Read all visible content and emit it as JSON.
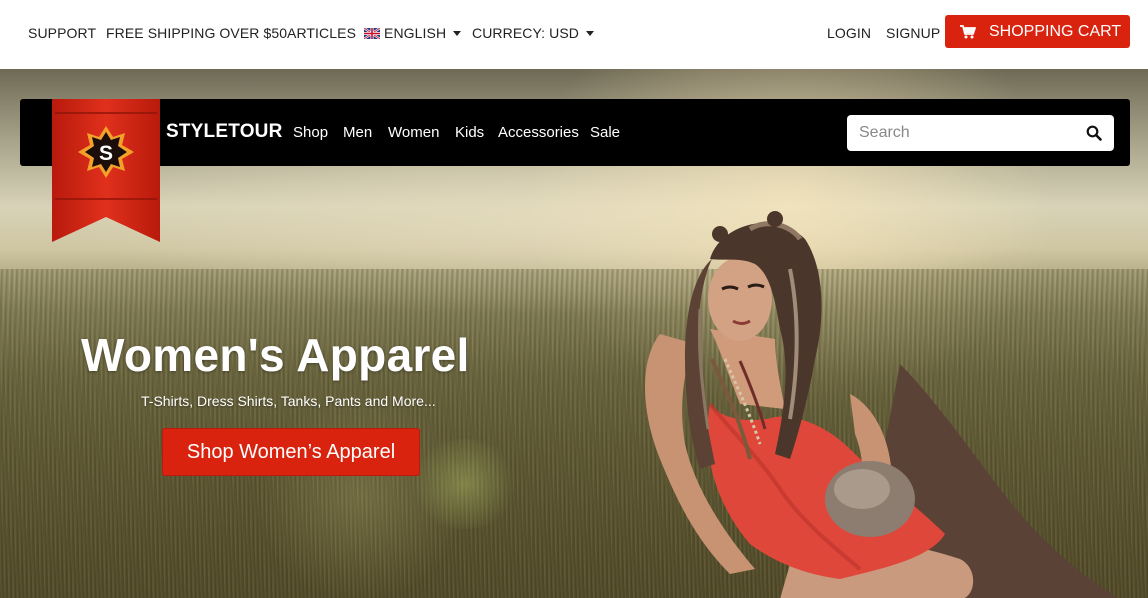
{
  "topbar": {
    "support": "SUPPORT",
    "shipping": "FREE SHIPPING OVER $50",
    "articles": "ARTICLES",
    "language": "ENGLISH",
    "currency": "CURRECY: USD",
    "login": "LOGIN",
    "signup": "SIGNUP",
    "cart": "SHOPPING CART"
  },
  "nav": {
    "brand": "STYLETOUR",
    "logo_letter": "S",
    "links": [
      "Shop",
      "Men",
      "Women",
      "Kids",
      "Accessories",
      "Sale"
    ],
    "search_placeholder": "Search"
  },
  "hero": {
    "title": "Women's Apparel",
    "subtitle": "T-Shirts, Dress Shirts, Tanks, Pants and More...",
    "cta": "Shop Women’s Apparel"
  },
  "colors": {
    "accent": "#d9230f",
    "nav_bg": "#000000"
  },
  "icons": {
    "flag": "uk-flag-icon",
    "cart": "cart-icon",
    "search": "search-icon",
    "caret": "chevron-down-icon"
  }
}
